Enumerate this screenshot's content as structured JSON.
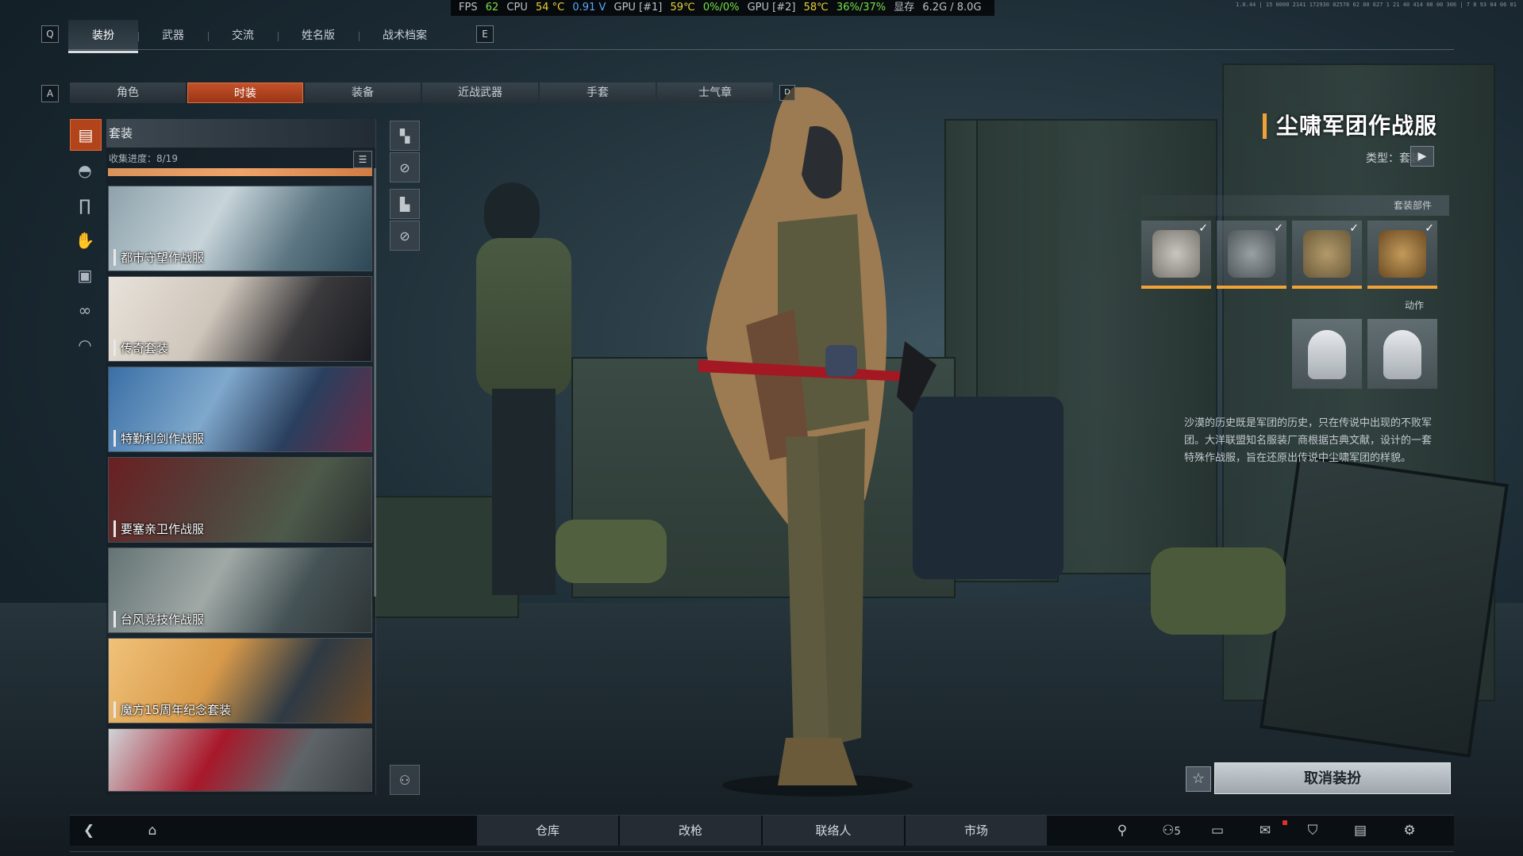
{
  "perf": {
    "fps_label": "FPS",
    "fps": "62",
    "cpu_label": "CPU",
    "cpu_temp": "54 °C",
    "cpu_volt": "0.91 V",
    "gpu1_label": "GPU [#1]",
    "gpu1_temp": "59℃",
    "gpu1_load": "0%/0%",
    "gpu2_label": "GPU [#2]",
    "gpu2_temp": "58℃",
    "gpu2_load": "36%/37%",
    "vram_label": "显存",
    "vram": "6.2G / 8.0G"
  },
  "sys_info": "1.0.44 | 15 0000 2141 172930 82578 62 80 627 1 21 40 414 08 00 306 | 7 8 93 04 06 01",
  "top_nav": {
    "left_key": "Q",
    "right_key": "E",
    "tabs": [
      "装扮",
      "武器",
      "交流",
      "姓名版",
      "战术档案"
    ]
  },
  "sub_nav": {
    "left_key": "A",
    "right_key": "D",
    "tabs": [
      "角色",
      "时装",
      "装备",
      "近战武器",
      "手套",
      "士气章"
    ]
  },
  "category_icons": [
    "outfit-icon",
    "helmet-icon",
    "pants-icon",
    "gloves-icon",
    "vest-icon",
    "goggles-icon",
    "cap-icon"
  ],
  "list": {
    "header": "套装",
    "progress": "收集进度：8/19",
    "items": [
      "都市守望作战服",
      "传奇套装",
      "特勤利剑作战服",
      "要塞亲卫作战服",
      "台风竞技作战服",
      "魔方15周年纪念套装",
      ""
    ]
  },
  "item": {
    "title": "尘啸军团作战服",
    "type": "类型：套装",
    "parts_label": "套装部件",
    "action_label": "动作",
    "description": "沙漠的历史既是军团的历史，只在传说中出现的不败军团。大洋联盟知名服装厂商根据古典文献，设计的一套特殊作战服，旨在还原出传说中尘啸军团的样貌。",
    "parts": [
      "face-mask",
      "jacket",
      "pants",
      "boots"
    ],
    "actions": [
      "pose-1",
      "pose-2"
    ]
  },
  "unequip_label": "取消装扮",
  "bottom_nav": {
    "main": [
      "仓库",
      "改枪",
      "联络人",
      "市场"
    ],
    "friend_count": "5"
  },
  "colors": {
    "accent": "#c4512a",
    "gold": "#f0a236",
    "fps": "#78e04a",
    "temp": "#e9d23a"
  }
}
